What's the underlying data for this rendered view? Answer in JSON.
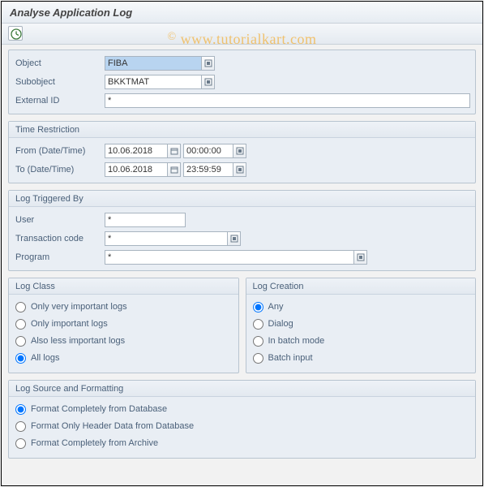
{
  "header": {
    "title": "Analyse Application Log"
  },
  "watermark": "www.tutorialkart.com",
  "general": {
    "object_label": "Object",
    "object_value": "FIBA",
    "subobject_label": "Subobject",
    "subobject_value": "BKKTMAT",
    "external_id_label": "External ID",
    "external_id_value": "*"
  },
  "time": {
    "title": "Time Restriction",
    "from_label": "From (Date/Time)",
    "from_date": "10.06.2018",
    "from_time": "00:00:00",
    "to_label": "To (Date/Time)",
    "to_date": "10.06.2018",
    "to_time": "23:59:59"
  },
  "trigger": {
    "title": "Log Triggered By",
    "user_label": "User",
    "user_value": "*",
    "tcode_label": "Transaction code",
    "tcode_value": "*",
    "program_label": "Program",
    "program_value": "*"
  },
  "log_class": {
    "title": "Log Class",
    "opt1": "Only very important logs",
    "opt2": "Only important logs",
    "opt3": "Also less important logs",
    "opt4": "All logs",
    "selected": "opt4"
  },
  "log_creation": {
    "title": "Log Creation",
    "opt1": "Any",
    "opt2": "Dialog",
    "opt3": "In batch mode",
    "opt4": "Batch input",
    "selected": "opt1"
  },
  "log_source": {
    "title": "Log Source and Formatting",
    "opt1": "Format Completely from Database",
    "opt2": "Format Only Header Data from Database",
    "opt3": "Format Completely from Archive",
    "selected": "opt1"
  }
}
